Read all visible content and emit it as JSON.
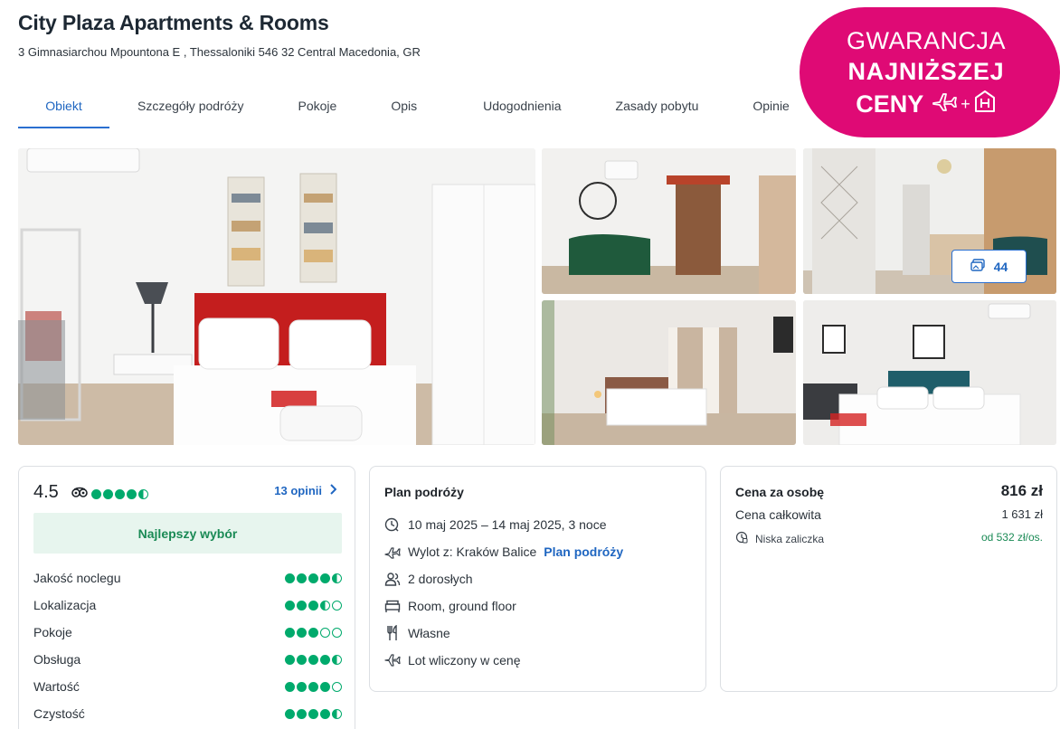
{
  "header": {
    "title": "City Plaza Apartments & Rooms",
    "address": "3 Gimnasiarchou Mpountona E , Thessaloniki 546 32 Central Macedonia, GR"
  },
  "tabs": [
    {
      "label": "Obiekt",
      "active": true
    },
    {
      "label": "Szczegóły podróży"
    },
    {
      "label": "Pokoje"
    },
    {
      "label": "Opis"
    },
    {
      "label": "Udogodnienia"
    },
    {
      "label": "Zasady pobytu"
    },
    {
      "label": "Opinie"
    }
  ],
  "badge": {
    "line1": "GWARANCJA",
    "line2": "NAJNIŻSZEJ",
    "line3": "CENY",
    "plus": "+",
    "icons": [
      "plane-icon",
      "hotel-h-icon"
    ],
    "color": "#df0a75"
  },
  "gallery": {
    "photos": [
      "bedroom-red-headboard",
      "lobby-green-sofa",
      "reception-corridor",
      "bedroom-window",
      "bedroom-teal-headboard"
    ],
    "photo_count": "44"
  },
  "ratings": {
    "score": "4.5",
    "score_fraction": 0.9,
    "reviews_link": "13 opinii",
    "best_choice": "Najlepszy wybór",
    "items": [
      {
        "label": "Jakość noclegu",
        "value": 4.5
      },
      {
        "label": "Lokalizacja",
        "value": 3.5
      },
      {
        "label": "Pokoje",
        "value": 3
      },
      {
        "label": "Obsługa",
        "value": 4.5
      },
      {
        "label": "Wartość",
        "value": 4
      },
      {
        "label": "Czystość",
        "value": 4.5
      }
    ],
    "accent": "#00aa6c"
  },
  "plan": {
    "title": "Plan podróży",
    "dates": "10 maj 2025 – 14 maj 2025, 3 noce",
    "departure": "Wylot z: Kraków Balice",
    "departure_link": "Plan podróży",
    "guests": "2 dorosłych",
    "room": "Room, ground floor",
    "board": "Własne",
    "flight": "Lot wliczony w cenę"
  },
  "price": {
    "per_person_label": "Cena za osobę",
    "per_person_value": "816 zł",
    "total_label": "Cena całkowita",
    "total_value": "1 631 zł",
    "deposit_label": "Niska zaliczka",
    "deposit_value": "od 532 zł/os."
  },
  "colors": {
    "link": "#1f66c1",
    "positive": "#1a8a55"
  }
}
